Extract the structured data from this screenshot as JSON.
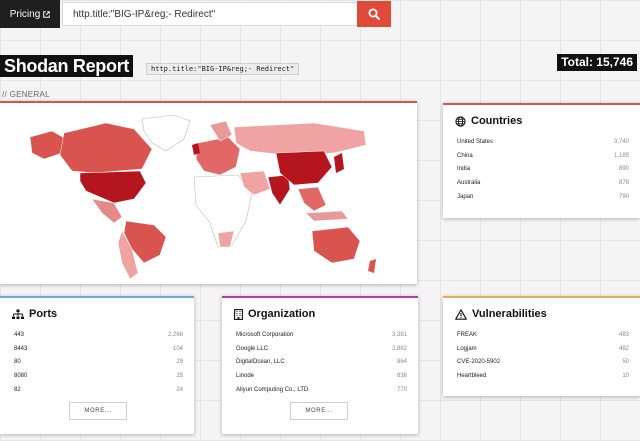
{
  "topbar": {
    "pricing_label": "Pricing",
    "search_value": "http.title:\"BIG-IP&reg;- Redirect\""
  },
  "header": {
    "title": "Shodan Report",
    "query": "http.title:\"BIG-IP&reg;- Redirect\"",
    "total": "Total: 15,746"
  },
  "section": {
    "general_label": "// GENERAL"
  },
  "countries": {
    "title": "Countries",
    "items": [
      {
        "name": "United States",
        "count": "3,740"
      },
      {
        "name": "China",
        "count": "1,185"
      },
      {
        "name": "India",
        "count": "890"
      },
      {
        "name": "Australia",
        "count": "878"
      },
      {
        "name": "Japan",
        "count": "790"
      }
    ]
  },
  "ports": {
    "title": "Ports",
    "more_label": "MORE...",
    "items": [
      {
        "name": "443",
        "count": "2,268"
      },
      {
        "name": "8443",
        "count": "104"
      },
      {
        "name": "80",
        "count": "29"
      },
      {
        "name": "8080",
        "count": "25"
      },
      {
        "name": "82",
        "count": "24"
      }
    ]
  },
  "organization": {
    "title": "Organization",
    "more_label": "MORE...",
    "items": [
      {
        "name": "Microsoft Corporation",
        "count": "3,381"
      },
      {
        "name": "Google LLC",
        "count": "2,882"
      },
      {
        "name": "DigitalOcean, LLC",
        "count": "864"
      },
      {
        "name": "Linode",
        "count": "838"
      },
      {
        "name": "Aliyun Computing Co., LTD",
        "count": "770"
      }
    ]
  },
  "vulnerabilities": {
    "title": "Vulnerabilities",
    "items": [
      {
        "name": "FREAK",
        "count": "483"
      },
      {
        "name": "Logjam",
        "count": "482"
      },
      {
        "name": "CVE-2020-5902",
        "count": "50"
      },
      {
        "name": "Heartbleed",
        "count": "10"
      }
    ]
  },
  "colors": {
    "accent_red": "#e04a39",
    "map_dark": "#b5151c",
    "map_mid": "#d9534f",
    "map_light": "#f0a3a3",
    "ports_border": "#6fa9dc",
    "org_border": "#b23cb8",
    "vuln_border": "#f0ad4e"
  }
}
